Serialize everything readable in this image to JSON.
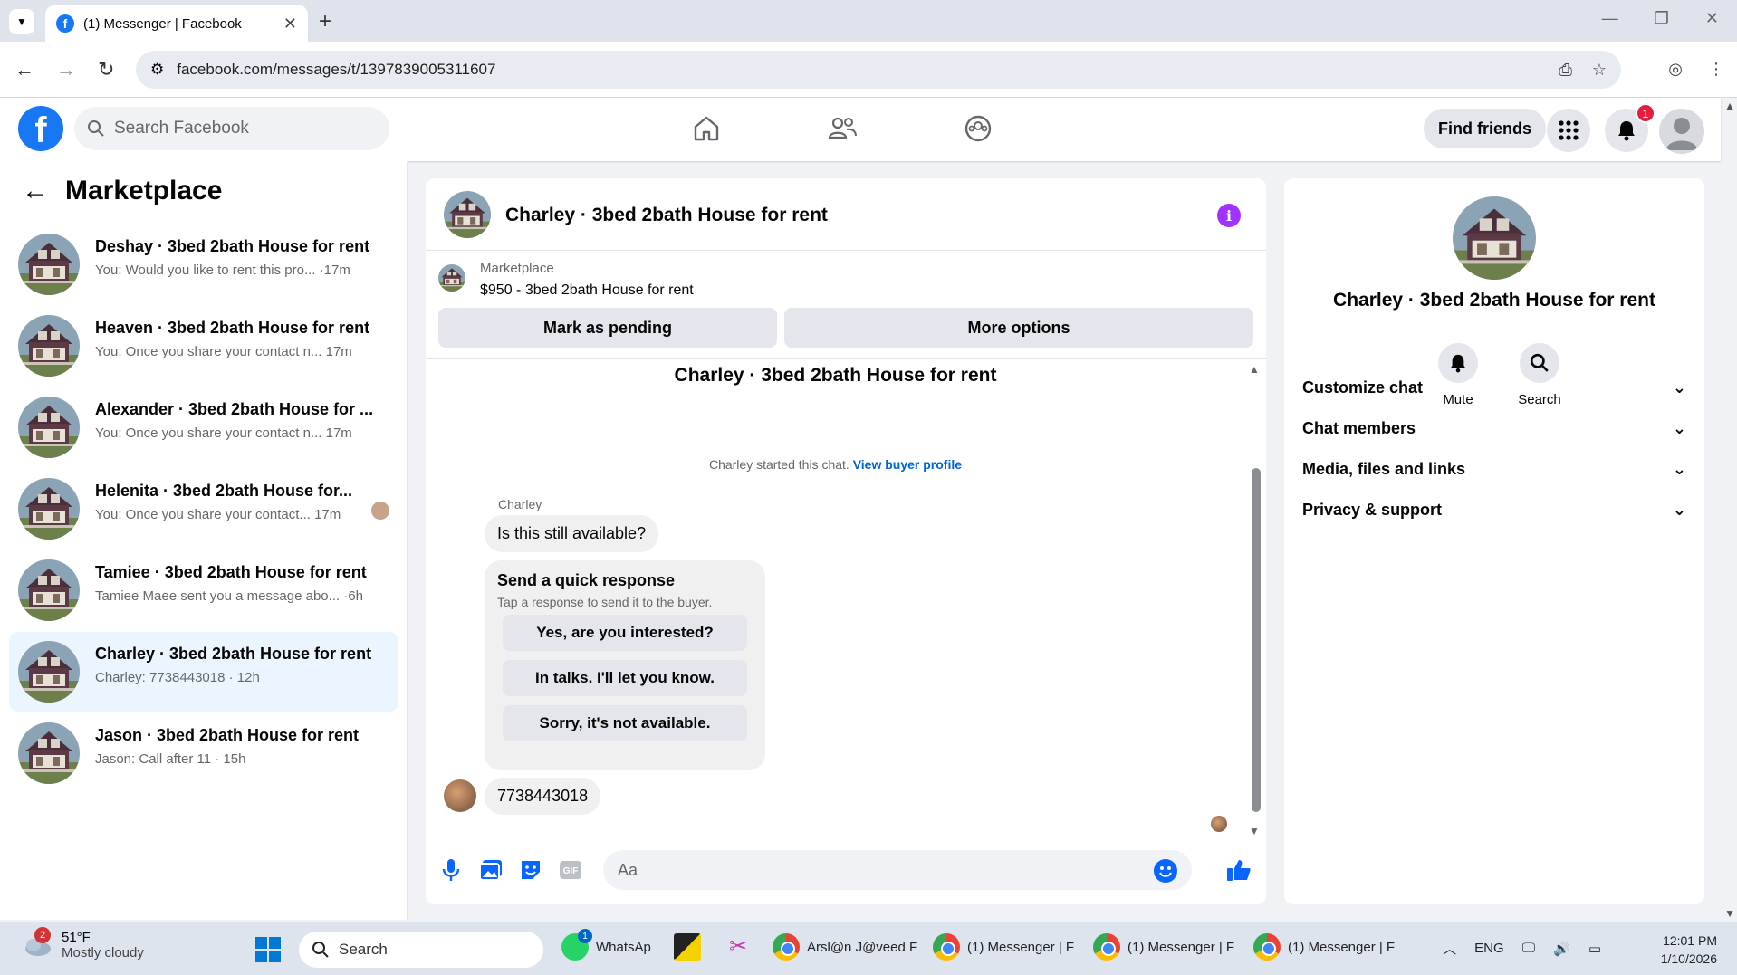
{
  "browser": {
    "tab_title": "(1) Messenger | Facebook",
    "url": "facebook.com/messages/t/1397839005311607"
  },
  "fb_header": {
    "search_placeholder": "Search Facebook",
    "find_friends": "Find friends",
    "notification_count": "1"
  },
  "left_panel": {
    "title": "Marketplace",
    "conversations": [
      {
        "name": "Deshay · 3bed 2bath House for rent",
        "snippet": "You: Would you like to rent this pro... ·17m"
      },
      {
        "name": "Heaven · 3bed 2bath House for rent",
        "snippet": "You: Once you share your contact n...   17m"
      },
      {
        "name": "Alexander · 3bed 2bath House for ...",
        "snippet": "You: Once you share your contact n...   17m"
      },
      {
        "name": "Helenita · 3bed 2bath House for...",
        "snippet": "You: Once you share your contact... 17m"
      },
      {
        "name": "Tamiee · 3bed 2bath House for rent",
        "snippet": "Tamiee Maee sent you a message abo... ·6h"
      },
      {
        "name": "Charley · 3bed 2bath House for rent",
        "snippet": "Charley: 7738443018 · 12h"
      },
      {
        "name": "Jason · 3bed 2bath House for rent",
        "snippet": "Jason: Call after 11 · 15h"
      }
    ]
  },
  "chat": {
    "header_name": "Charley · 3bed 2bath House for rent",
    "listing_source": "Marketplace",
    "listing_title": "$950 - 3bed 2bath House for rent",
    "mark_pending": "Mark as pending",
    "more_options": "More options",
    "thread_title": "Charley · 3bed 2bath House for rent",
    "started_text": "Charley started this chat.",
    "view_buyer_profile": "View buyer profile",
    "sender_name": "Charley",
    "message_1": "Is this still available?",
    "quick_title": "Send a quick response",
    "quick_sub": "Tap a response to send it to the buyer.",
    "quick_responses": [
      "Yes, are you interested?",
      "In talks. I'll let you know.",
      "Sorry, it's not available."
    ],
    "message_2": "7738443018",
    "composer_placeholder": "Aa"
  },
  "right_panel": {
    "name": "Charley · 3bed 2bath House for rent",
    "mute": "Mute",
    "search": "Search",
    "sections": [
      "Customize chat",
      "Chat members",
      "Media, files and links",
      "Privacy & support"
    ]
  },
  "taskbar": {
    "weather_temp": "51°F",
    "weather_desc": "Mostly cloudy",
    "weather_badge": "2",
    "search": "Search",
    "whatsapp": "WhatsAp",
    "whatsapp_badge": "1",
    "chrome_1": "Arsl@n J@veed F",
    "chrome_2": "(1) Messenger | F",
    "chrome_3": "(1) Messenger | F",
    "chrome_4": "(1) Messenger | F",
    "lang": "ENG",
    "time": "12:01 PM",
    "date": "1/10/2026"
  },
  "colors": {
    "fb_blue": "#1877f2",
    "active_conv": "#ebf5ff",
    "info_purple": "#a033ff",
    "composer_blue": "#0866ff"
  }
}
